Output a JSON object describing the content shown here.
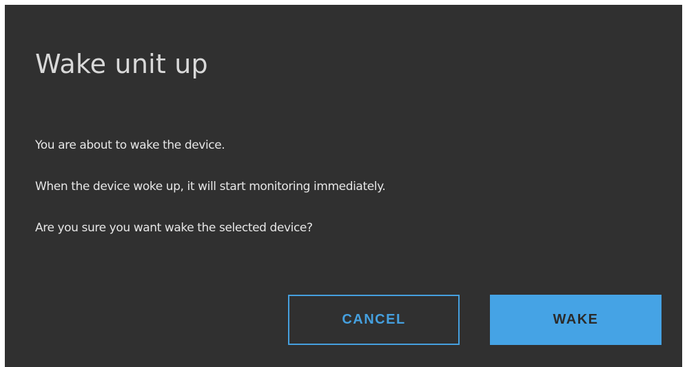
{
  "dialog": {
    "title": "Wake unit up",
    "messages": [
      "You are about to wake the device.",
      "When the device woke up, it will start monitoring immediately.",
      "Are you sure you want wake the selected device?"
    ],
    "buttons": {
      "cancel_label": "CANCEL",
      "wake_label": "WAKE"
    }
  },
  "colors": {
    "dialog_background": "#303030",
    "title_text": "#d9d9d9",
    "body_text": "#e6e6e6",
    "accent": "#45a3e5",
    "primary_button_text": "#2b2b2b"
  }
}
